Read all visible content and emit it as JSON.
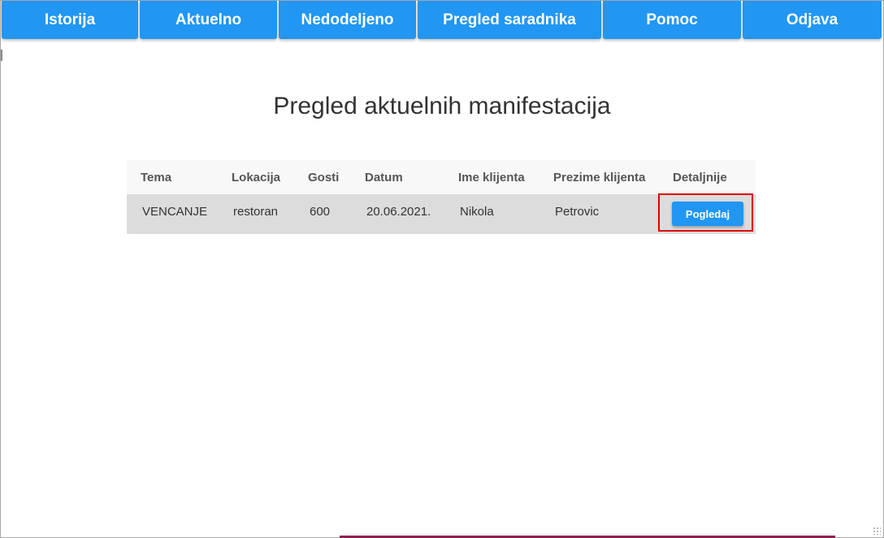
{
  "nav": {
    "items": [
      {
        "label": "Istorija"
      },
      {
        "label": "Aktuelno"
      },
      {
        "label": "Nedodeljeno"
      },
      {
        "label": "Pregled saradnika"
      },
      {
        "label": "Pomoc"
      },
      {
        "label": "Odjava"
      }
    ]
  },
  "page": {
    "title": "Pregled aktuelnih manifestacija"
  },
  "table": {
    "headers": [
      "Tema",
      "Lokacija",
      "Gosti",
      "Datum",
      "Ime klijenta",
      "Prezime klijenta",
      "Detaljnije"
    ],
    "rows": [
      {
        "tema": "VENCANJE",
        "lokacija": "restoran",
        "gosti": "600",
        "datum": "20.06.2021.",
        "ime": "Nikola",
        "prezime": "Petrovic",
        "button_label": "Pogledaj"
      }
    ]
  },
  "colors": {
    "primary": "#2196f3",
    "highlight": "#e00000",
    "row_bg": "#dcdcdc",
    "header_bg": "#f8f8f8"
  }
}
